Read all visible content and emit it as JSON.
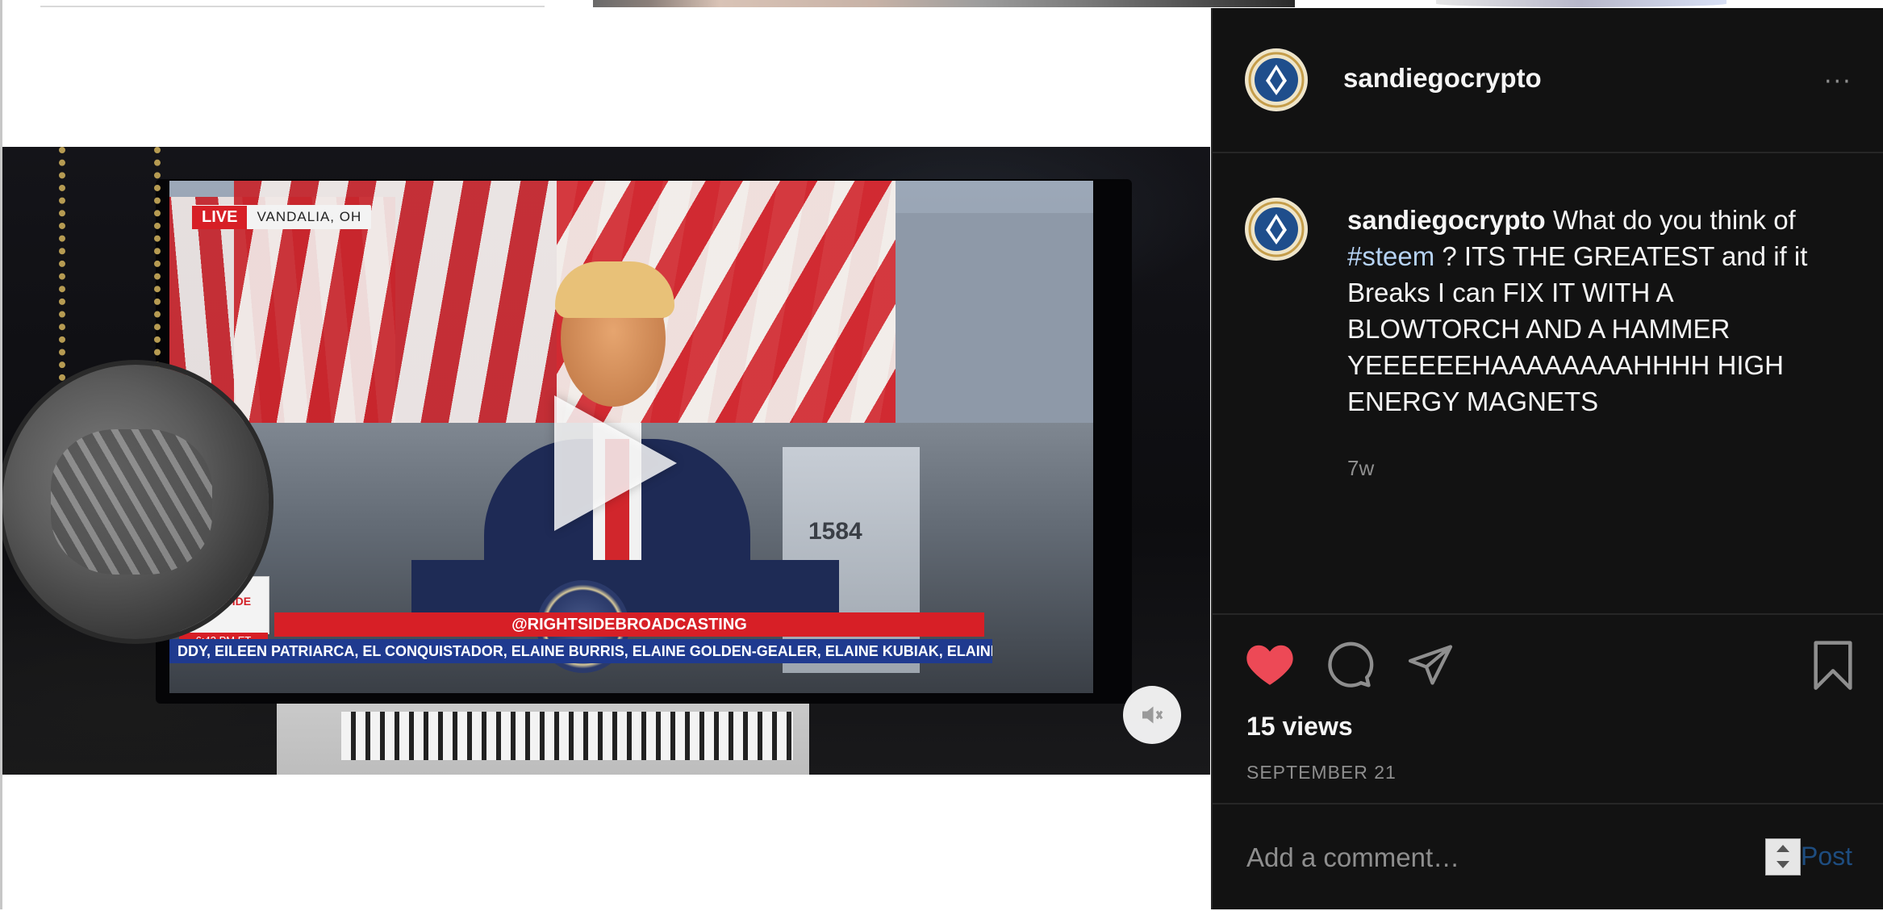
{
  "post": {
    "username": "sandiegocrypto",
    "more_label": "···",
    "caption_before": " What do you think of ",
    "hashtag": "#steem",
    "caption_after": " ? ITS THE GREATEST and if it Breaks I can FIX IT WITH A BLOWTORCH AND A HAMMER YEEEEEEHAAAAAAAAHHHH HIGH ENERGY MAGNETS",
    "age": "7w",
    "views": "15 views",
    "date": "SEPTEMBER 21",
    "liked": true
  },
  "video": {
    "live_label": "LIVE",
    "location": "VANDALIA, OH",
    "banner": "@RIGHTSIDEBROADCASTING",
    "ticker": "DDY, EILEEN PATRIARCA, EL CONQUISTADOR, ELAINE BURRIS, ELAINE GOLDEN-GEALER, ELAINE KUBIAK, ELAINE KUR",
    "logo_text": "RIGHT SIDE",
    "time": "6:43 PM ET",
    "machine_number": "1584"
  },
  "comment": {
    "placeholder": "Add a comment…",
    "post_label": "Post"
  },
  "colors": {
    "panel_bg": "#121212",
    "like": "#ed4956",
    "hashtag": "#b6d3f5",
    "post_button": "#1e4d80",
    "muted_text": "#8e8e8e"
  },
  "icons": {
    "like": "heart-icon",
    "comment": "comment-bubble-icon",
    "share": "paper-plane-icon",
    "save": "bookmark-icon",
    "play": "play-icon",
    "mute": "speaker-muted-icon"
  }
}
